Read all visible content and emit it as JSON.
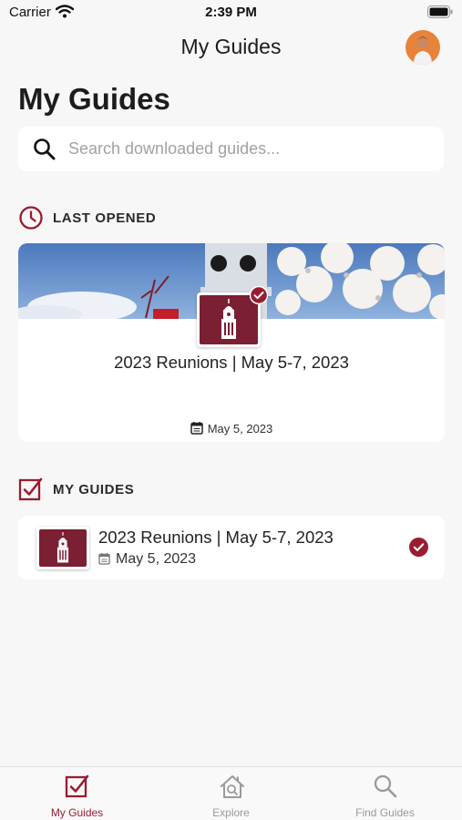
{
  "status_bar": {
    "carrier": "Carrier",
    "time": "2:39 PM"
  },
  "nav": {
    "title": "My Guides"
  },
  "page": {
    "title": "My Guides"
  },
  "search": {
    "placeholder": "Search downloaded guides..."
  },
  "last_opened": {
    "section_label": "LAST OPENED",
    "card": {
      "title": "2023 Reunions | May 5-7, 2023",
      "date": "May 5, 2023"
    }
  },
  "my_guides": {
    "section_label": "MY GUIDES",
    "items": [
      {
        "title": "2023 Reunions | May 5-7, 2023",
        "date": "May 5, 2023"
      }
    ]
  },
  "tabs": [
    {
      "label": "My Guides",
      "icon": "checkbox-icon",
      "active": true
    },
    {
      "label": "Explore",
      "icon": "house-search-icon",
      "active": false
    },
    {
      "label": "Find Guides",
      "icon": "search-icon",
      "active": false
    }
  ],
  "colors": {
    "accent": "#9b1b30",
    "thumb": "#7b1f33",
    "inactive": "#9a9a9a"
  }
}
